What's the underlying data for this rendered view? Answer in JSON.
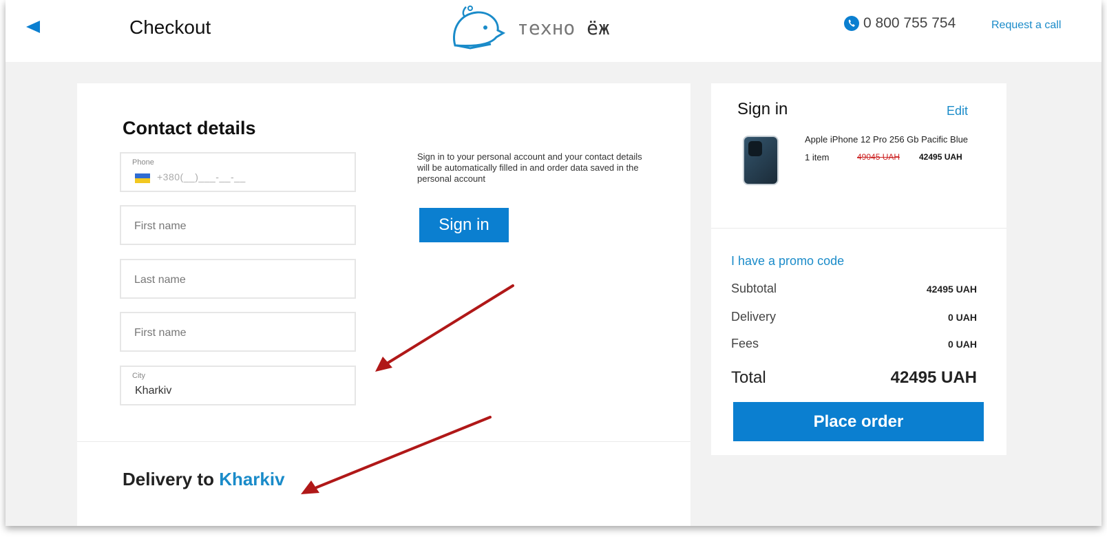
{
  "header": {
    "title": "Checkout",
    "logo_part1": "техно",
    "logo_part2": "ёж",
    "phone": "0 800 755 754",
    "request_call": "Request a call"
  },
  "contact": {
    "title": "Contact details",
    "phone_label": "Phone",
    "phone_mask": "+380(__)___-__-__",
    "first_name_placeholder": "First name",
    "last_name_placeholder": "Last name",
    "first_name_placeholder_2": "First name",
    "city_label": "City",
    "city_value": "Kharkiv"
  },
  "signin_panel": {
    "info": "Sign in to your personal account and your contact details will be automatically filled in and order data saved in the personal account",
    "button": "Sign in"
  },
  "delivery": {
    "prefix": "Delivery to",
    "city": "Kharkiv"
  },
  "summary": {
    "title": "Sign in",
    "edit": "Edit",
    "product_name": "Apple iPhone 12 Pro 256 Gb Pacific Blue",
    "quantity": "1 item",
    "old_price": "49045 UAH",
    "new_price": "42495 UAH",
    "promo": "I have a promo code",
    "subtotal_label": "Subtotal",
    "subtotal_value": "42495 UAH",
    "delivery_label": "Delivery",
    "delivery_value": "0 UAH",
    "fees_label": "Fees",
    "fees_value": "0 UAH",
    "total_label": "Total",
    "total_value": "42495 UAH",
    "place_order": "Place order"
  },
  "colors": {
    "accent": "#0b7fd0",
    "link": "#1a8bc9",
    "annotation_arrow": "#b01818"
  }
}
